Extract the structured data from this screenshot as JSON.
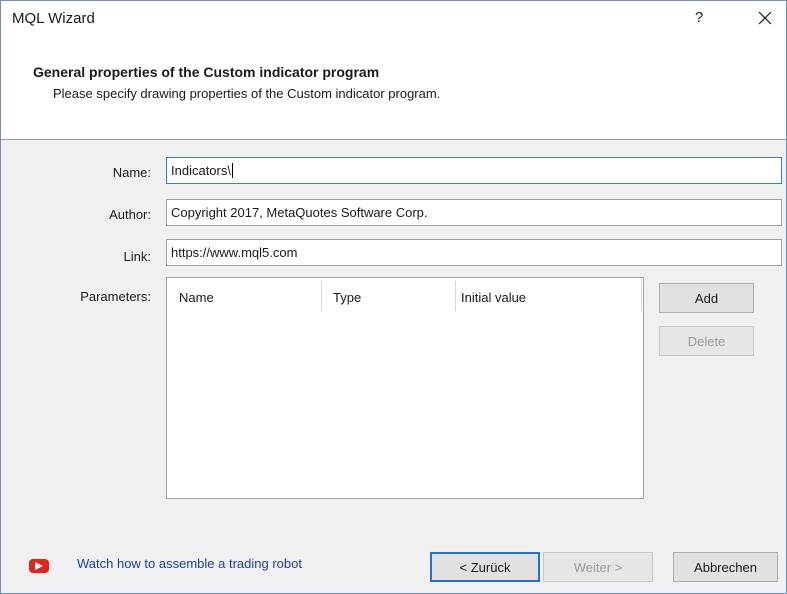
{
  "window": {
    "title": "MQL Wizard",
    "help_label": "?"
  },
  "header": {
    "heading": "General properties of the Custom indicator program",
    "subheading": "Please specify drawing properties of the Custom indicator program."
  },
  "form": {
    "name": {
      "label": "Name:",
      "value": "Indicators\\"
    },
    "author": {
      "label": "Author:",
      "value": "Copyright 2017, MetaQuotes Software Corp."
    },
    "link": {
      "label": "Link:",
      "value": "https://www.mql5.com"
    },
    "parameters": {
      "label": "Parameters:",
      "columns": [
        "Name",
        "Type",
        "Initial value"
      ],
      "rows": []
    }
  },
  "side_buttons": {
    "add": "Add",
    "delete": "Delete"
  },
  "footer": {
    "video_link": "Watch how to assemble a trading robot",
    "back": "< Zurück",
    "next": "Weiter >",
    "cancel": "Abbrechen"
  },
  "icons": {
    "close": "close-icon",
    "video": "youtube-play-icon"
  },
  "colors": {
    "link": "#1c3fa8",
    "focus_border": "#3a7bd5",
    "youtube_red": "#e1251b"
  }
}
